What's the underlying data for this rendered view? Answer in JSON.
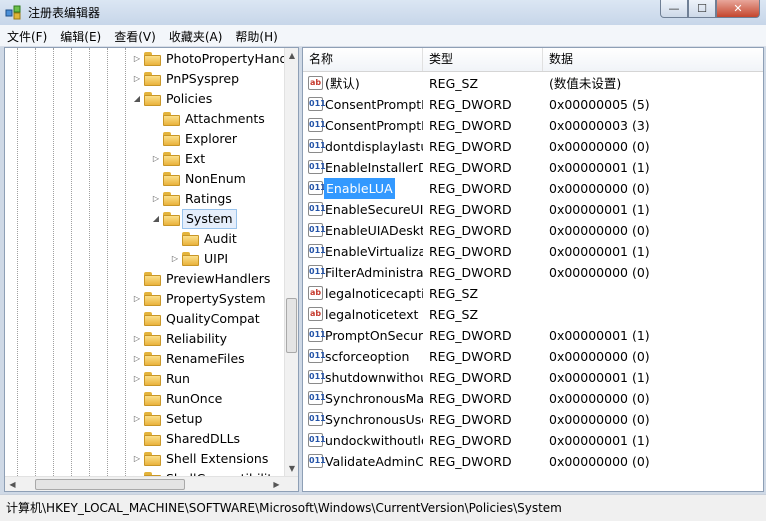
{
  "window": {
    "title": "注册表编辑器",
    "minimize": "—",
    "maximize": "☐",
    "close": "✕"
  },
  "menu": [
    "文件(F)",
    "编辑(E)",
    "查看(V)",
    "收藏夹(A)",
    "帮助(H)"
  ],
  "tree": [
    {
      "label": "PhotoPropertyHandler",
      "level": 0,
      "toggle": "collapsed"
    },
    {
      "label": "PnPSysprep",
      "level": 0,
      "toggle": "collapsed"
    },
    {
      "label": "Policies",
      "level": 0,
      "toggle": "expanded"
    },
    {
      "label": "Attachments",
      "level": 1,
      "toggle": "none"
    },
    {
      "label": "Explorer",
      "level": 1,
      "toggle": "none"
    },
    {
      "label": "Ext",
      "level": 1,
      "toggle": "collapsed"
    },
    {
      "label": "NonEnum",
      "level": 1,
      "toggle": "none"
    },
    {
      "label": "Ratings",
      "level": 1,
      "toggle": "collapsed"
    },
    {
      "label": "System",
      "level": 1,
      "toggle": "expanded",
      "selected": true
    },
    {
      "label": "Audit",
      "level": 2,
      "toggle": "none"
    },
    {
      "label": "UIPI",
      "level": 2,
      "toggle": "collapsed"
    },
    {
      "label": "PreviewHandlers",
      "level": 0,
      "toggle": "none"
    },
    {
      "label": "PropertySystem",
      "level": 0,
      "toggle": "collapsed"
    },
    {
      "label": "QualityCompat",
      "level": 0,
      "toggle": "none"
    },
    {
      "label": "Reliability",
      "level": 0,
      "toggle": "collapsed"
    },
    {
      "label": "RenameFiles",
      "level": 0,
      "toggle": "collapsed"
    },
    {
      "label": "Run",
      "level": 0,
      "toggle": "collapsed"
    },
    {
      "label": "RunOnce",
      "level": 0,
      "toggle": "none"
    },
    {
      "label": "Setup",
      "level": 0,
      "toggle": "collapsed"
    },
    {
      "label": "SharedDLLs",
      "level": 0,
      "toggle": "none"
    },
    {
      "label": "Shell Extensions",
      "level": 0,
      "toggle": "collapsed"
    },
    {
      "label": "ShellCompatibility",
      "level": 0,
      "toggle": "collapsed"
    }
  ],
  "list": {
    "columns": [
      "名称",
      "类型",
      "数据"
    ],
    "rows": [
      {
        "icon": "sz",
        "name": "(默认)",
        "type": "REG_SZ",
        "data": "(数值未设置)"
      },
      {
        "icon": "dw",
        "name": "ConsentPromptBehaviorAdmin",
        "type": "REG_DWORD",
        "data": "0x00000005 (5)"
      },
      {
        "icon": "dw",
        "name": "ConsentPromptBehaviorUser",
        "type": "REG_DWORD",
        "data": "0x00000003 (3)"
      },
      {
        "icon": "dw",
        "name": "dontdisplaylastusername",
        "type": "REG_DWORD",
        "data": "0x00000000 (0)"
      },
      {
        "icon": "dw",
        "name": "EnableInstallerDetection",
        "type": "REG_DWORD",
        "data": "0x00000001 (1)"
      },
      {
        "icon": "dw",
        "name": "EnableLUA",
        "type": "REG_DWORD",
        "data": "0x00000000 (0)",
        "selected": true
      },
      {
        "icon": "dw",
        "name": "EnableSecureUIAPaths",
        "type": "REG_DWORD",
        "data": "0x00000001 (1)"
      },
      {
        "icon": "dw",
        "name": "EnableUIADesktopToggle",
        "type": "REG_DWORD",
        "data": "0x00000000 (0)"
      },
      {
        "icon": "dw",
        "name": "EnableVirtualization",
        "type": "REG_DWORD",
        "data": "0x00000001 (1)"
      },
      {
        "icon": "dw",
        "name": "FilterAdministratorToken",
        "type": "REG_DWORD",
        "data": "0x00000000 (0)"
      },
      {
        "icon": "sz",
        "name": "legalnoticecaption",
        "type": "REG_SZ",
        "data": ""
      },
      {
        "icon": "sz",
        "name": "legalnoticetext",
        "type": "REG_SZ",
        "data": ""
      },
      {
        "icon": "dw",
        "name": "PromptOnSecureDesktop",
        "type": "REG_DWORD",
        "data": "0x00000001 (1)"
      },
      {
        "icon": "dw",
        "name": "scforceoption",
        "type": "REG_DWORD",
        "data": "0x00000000 (0)"
      },
      {
        "icon": "dw",
        "name": "shutdownwithoutlogon",
        "type": "REG_DWORD",
        "data": "0x00000001 (1)"
      },
      {
        "icon": "dw",
        "name": "SynchronousMachineGroupPolicy",
        "type": "REG_DWORD",
        "data": "0x00000000 (0)"
      },
      {
        "icon": "dw",
        "name": "SynchronousUserGroupPolicy",
        "type": "REG_DWORD",
        "data": "0x00000000 (0)"
      },
      {
        "icon": "dw",
        "name": "undockwithoutlogon",
        "type": "REG_DWORD",
        "data": "0x00000001 (1)"
      },
      {
        "icon": "dw",
        "name": "ValidateAdminCodeSignatures",
        "type": "REG_DWORD",
        "data": "0x00000000 (0)"
      }
    ]
  },
  "icons": {
    "string_value": "ab",
    "dword_value": "011"
  },
  "status": "计算机\\HKEY_LOCAL_MACHINE\\SOFTWARE\\Microsoft\\Windows\\CurrentVersion\\Policies\\System"
}
